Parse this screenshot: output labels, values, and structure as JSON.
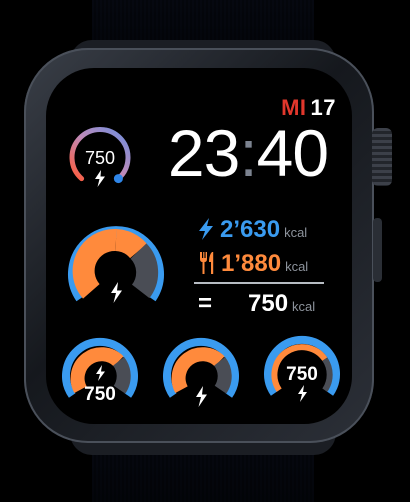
{
  "date": {
    "weekday": "MI",
    "day": "17"
  },
  "time": {
    "hours": "23",
    "separator": ":",
    "minutes": "40"
  },
  "complications": {
    "top_left": {
      "value": "750",
      "level": 0.85,
      "icon": "bolt-icon"
    },
    "center_left": {
      "level": 0.75,
      "icon": "bolt-icon"
    },
    "bottom_left": {
      "value": "750",
      "level": 0.75,
      "icon": "bolt-icon"
    },
    "bottom_center": {
      "level": 0.75,
      "icon": "bolt-icon"
    },
    "bottom_right": {
      "value": "750",
      "level": 0.85,
      "icon": "bolt-icon"
    }
  },
  "energy": {
    "burned": {
      "value": "2’630",
      "unit": "kcal",
      "icon": "bolt-icon",
      "color": "#3a9bf0"
    },
    "consumed": {
      "value": "1’880",
      "unit": "kcal",
      "icon": "fork-knife-icon",
      "color": "#ff8a3c"
    },
    "net": {
      "symbol": "=",
      "value": "750",
      "unit": "kcal"
    }
  },
  "colors": {
    "blue": "#3a9bf0",
    "orange": "#ff8a3c",
    "red": "#e2372c",
    "gray": "#4a4d55"
  }
}
